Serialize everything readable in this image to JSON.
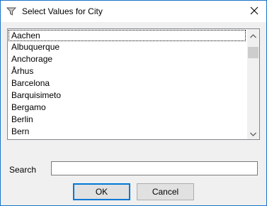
{
  "window": {
    "title": "Select Values for City"
  },
  "list": {
    "items": [
      "Aachen",
      "Albuquerque",
      "Anchorage",
      "Århus",
      "Barcelona",
      "Barquisimeto",
      "Bergamo",
      "Berlin",
      "Bern"
    ],
    "focused_item": "Aachen",
    "scroll_position": 0.08
  },
  "search": {
    "label": "Search",
    "value": ""
  },
  "buttons": {
    "ok": "OK",
    "cancel": "Cancel"
  },
  "icons": {
    "title": "filter-icon",
    "close": "close-icon",
    "scroll_up": "scroll-up-arrow-icon",
    "scroll_down": "scroll-down-arrow-icon"
  },
  "colors": {
    "window_border": "#1a74c8",
    "default_button_border": "#0078d7",
    "background": "#f0f0f0"
  }
}
